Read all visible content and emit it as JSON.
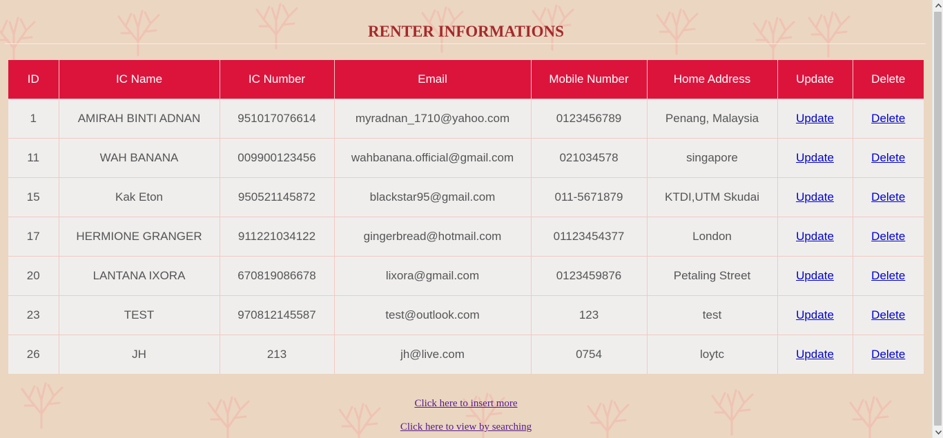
{
  "page": {
    "title": "RENTER INFORMATIONS"
  },
  "table": {
    "headers": [
      "ID",
      "IC Name",
      "IC Number",
      "Email",
      "Mobile Number",
      "Home Address",
      "Update",
      "Delete"
    ],
    "rows": [
      {
        "id": "1",
        "name": "AMIRAH BINTI ADNAN",
        "ic": "951017076614",
        "email": "myradnan_1710@yahoo.com",
        "mobile": "0123456789",
        "address": "Penang, Malaysia",
        "update": "Update",
        "delete": "Delete"
      },
      {
        "id": "11",
        "name": "WAH BANANA",
        "ic": "009900123456",
        "email": "wahbanana.official@gmail.com",
        "mobile": "021034578",
        "address": "singapore",
        "update": "Update",
        "delete": "Delete"
      },
      {
        "id": "15",
        "name": "Kak Eton",
        "ic": "950521145872",
        "email": "blackstar95@gmail.com",
        "mobile": "011-5671879",
        "address": "KTDI,UTM Skudai",
        "update": "Update",
        "delete": "Delete"
      },
      {
        "id": "17",
        "name": "HERMIONE GRANGER",
        "ic": "911221034122",
        "email": "gingerbread@hotmail.com",
        "mobile": "01123454377",
        "address": "London",
        "update": "Update",
        "delete": "Delete"
      },
      {
        "id": "20",
        "name": "LANTANA IXORA",
        "ic": "670819086678",
        "email": "lixora@gmail.com",
        "mobile": "0123459876",
        "address": "Petaling Street",
        "update": "Update",
        "delete": "Delete"
      },
      {
        "id": "23",
        "name": "TEST",
        "ic": "970812145587",
        "email": "test@outlook.com",
        "mobile": "123",
        "address": "test",
        "update": "Update",
        "delete": "Delete"
      },
      {
        "id": "26",
        "name": "JH",
        "ic": "213",
        "email": "jh@live.com",
        "mobile": "0754",
        "address": "loytc",
        "update": "Update",
        "delete": "Delete"
      }
    ]
  },
  "links": {
    "insert": "Click here to insert more",
    "search": "Click here to view by searching"
  },
  "colors": {
    "background": "#ebd6c2",
    "header_bg": "#dc143c",
    "title_color": "#a52a2a",
    "coral_pattern": "#f3b5a8"
  },
  "icons": {
    "scroll_up": "scroll-up-arrow-icon",
    "scroll_down": "scroll-down-arrow-icon"
  }
}
